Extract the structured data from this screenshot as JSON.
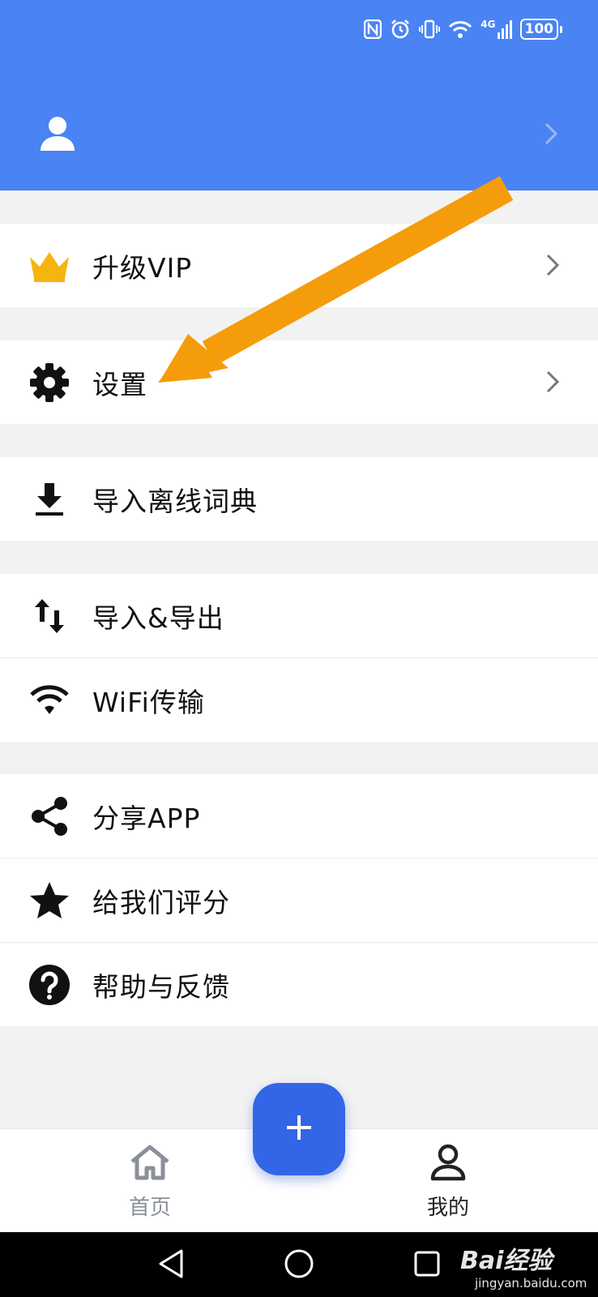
{
  "status_bar": {
    "icons": [
      "nfc-icon",
      "alarm-icon",
      "vibrate-icon",
      "wifi-icon",
      "signal-4g-icon"
    ],
    "network": "4G",
    "battery": "100"
  },
  "profile": {
    "avatar_icon": "user-icon",
    "chevron_icon": "chevron-right-icon"
  },
  "menu": {
    "vip": {
      "label": "升级VIP",
      "icon": "crown-icon",
      "icon_color": "#f6b40e"
    },
    "settings": {
      "label": "设置",
      "icon": "gear-icon"
    },
    "import_dict": {
      "label": "导入离线词典",
      "icon": "download-icon"
    },
    "import_export": {
      "label": "导入&导出",
      "icon": "swap-vertical-icon"
    },
    "wifi": {
      "label": "WiFi传输",
      "icon": "wifi-icon"
    },
    "share": {
      "label": "分享APP",
      "icon": "share-icon"
    },
    "rate": {
      "label": "给我们评分",
      "icon": "star-icon"
    },
    "help": {
      "label": "帮助与反馈",
      "icon": "help-icon"
    }
  },
  "tabs": {
    "home": {
      "label": "首页",
      "icon": "home-icon"
    },
    "mine": {
      "label": "我的",
      "icon": "person-icon"
    }
  },
  "fab": {
    "icon": "plus-icon"
  },
  "nav": {
    "back": "back-icon",
    "home": "home-circle-icon",
    "recents": "recents-icon"
  },
  "watermark": {
    "logo": "Bai经验",
    "url": "jingyan.baidu.com"
  },
  "colors": {
    "header": "#4a83f3",
    "accent": "#3366e6",
    "arrow": "#f59c0a"
  }
}
